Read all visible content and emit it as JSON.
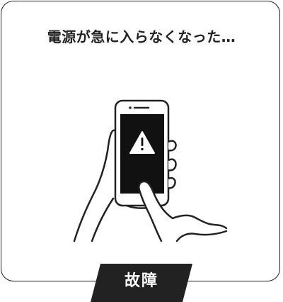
{
  "headline": "電源が急に入らなくなった…",
  "label": "故障",
  "colors": {
    "ink": "#222222",
    "screen": "#111111",
    "background": "#ffffff"
  },
  "icons": {
    "illustration": "hand-holding-smartphone-with-warning",
    "warning": "warning-triangle-icon"
  }
}
